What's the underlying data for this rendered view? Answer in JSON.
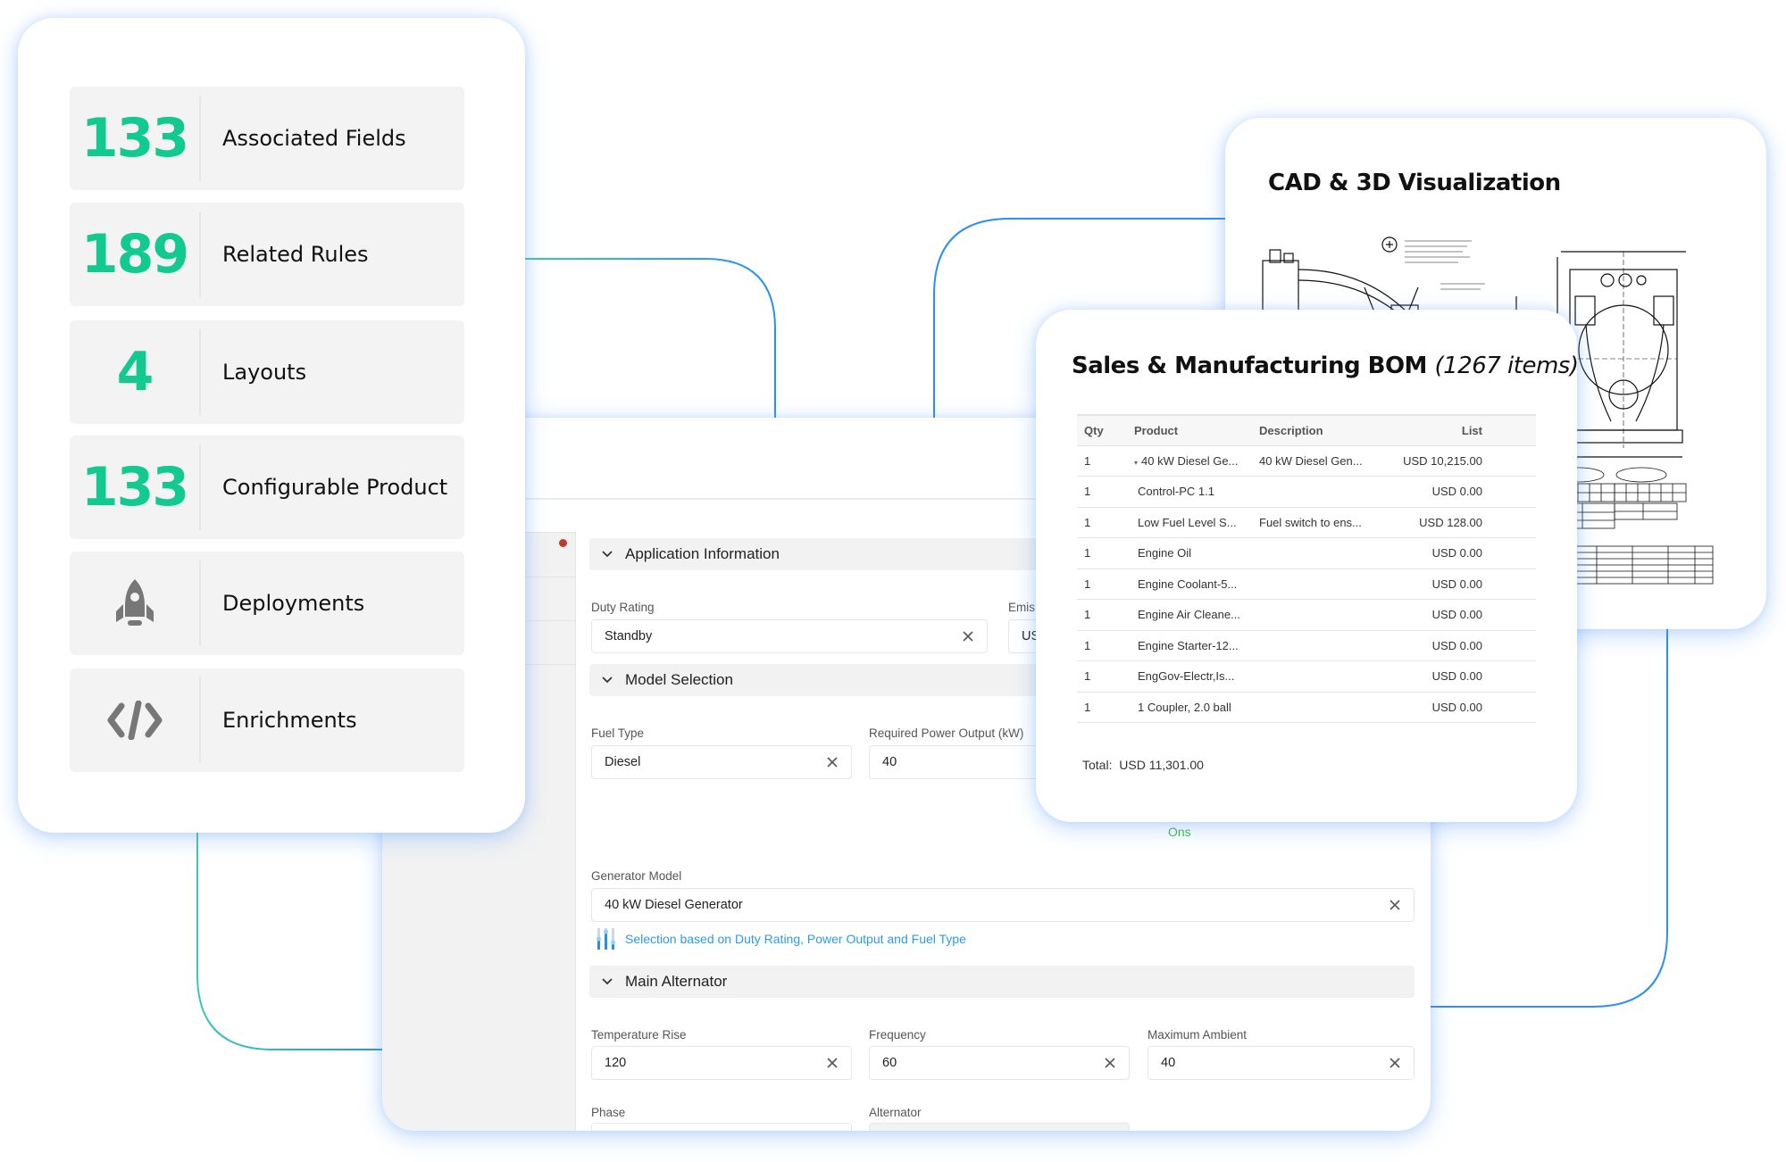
{
  "colors": {
    "accent_green": "#12c98f",
    "connector_blue": "#2b8ff0",
    "connector_teal": "#3cc8b4",
    "hint_blue": "#2a9de0",
    "status_green": "#3cc13b",
    "required_red": "#c0392b"
  },
  "stats": {
    "items": [
      {
        "value": "133",
        "label": "Associated Fields"
      },
      {
        "value": "189",
        "label": "Related Rules"
      },
      {
        "value": "4",
        "label": "Layouts"
      },
      {
        "value": "133",
        "label": "Configurable Product"
      },
      {
        "icon": "rocket-icon",
        "label": "Deployments"
      },
      {
        "icon": "code-icon",
        "label": "Enrichments"
      }
    ]
  },
  "form": {
    "sections": {
      "application_information": "Application Information",
      "model_selection": "Model Selection",
      "main_alternator": "Main Alternator"
    },
    "fields": {
      "duty_rating": {
        "label": "Duty Rating",
        "value": "Standby"
      },
      "emissions": {
        "label": "Emis",
        "value": "US"
      },
      "fuel_type": {
        "label": "Fuel Type",
        "value": "Diesel"
      },
      "required_power_output": {
        "label": "Required Power Output (kW)",
        "value": "40"
      },
      "generator_model": {
        "label": "Generator Model",
        "value": "40 kW Diesel Generator"
      },
      "temperature_rise": {
        "label": "Temperature Rise",
        "value": "120"
      },
      "frequency": {
        "label": "Frequency",
        "value": "60"
      },
      "maximum_ambient": {
        "label": "Maximum Ambient",
        "value": "40"
      },
      "phase": {
        "label": "Phase",
        "value": ""
      },
      "alternator": {
        "label": "Alternator",
        "value": ""
      }
    },
    "selection_hint": "Selection based on Duty Rating, Power Output and Fuel Type",
    "status_text": "Ons"
  },
  "bom": {
    "title": "Sales & Manufacturing BOM",
    "count": "(1267 items)",
    "columns": [
      "Qty",
      "Product",
      "Description",
      "List"
    ],
    "rows": [
      {
        "qty": "1",
        "product": "40 kW Diesel Ge...",
        "description": "40 kW Diesel Gen...",
        "list": "USD 10,215.00",
        "expandable": true
      },
      {
        "qty": "1",
        "product": "Control-PC 1.1",
        "description": "",
        "list": "USD 0.00"
      },
      {
        "qty": "1",
        "product": "Low Fuel Level S...",
        "description": "Fuel switch to ens...",
        "list": "USD 128.00"
      },
      {
        "qty": "1",
        "product": "Engine Oil",
        "description": "",
        "list": "USD 0.00"
      },
      {
        "qty": "1",
        "product": "Engine Coolant-5...",
        "description": "",
        "list": "USD 0.00"
      },
      {
        "qty": "1",
        "product": "Engine Air Cleane...",
        "description": "",
        "list": "USD 0.00"
      },
      {
        "qty": "1",
        "product": "Engine Starter-12...",
        "description": "",
        "list": "USD 0.00"
      },
      {
        "qty": "1",
        "product": "EngGov-Electr,Is...",
        "description": "",
        "list": "USD 0.00"
      },
      {
        "qty": "1",
        "product": "1 Coupler, 2.0 ball",
        "description": "",
        "list": "USD 0.00"
      }
    ],
    "total_label": "Total:",
    "total_value": "USD 11,301.00"
  },
  "cad": {
    "title": "CAD & 3D Visualization"
  }
}
